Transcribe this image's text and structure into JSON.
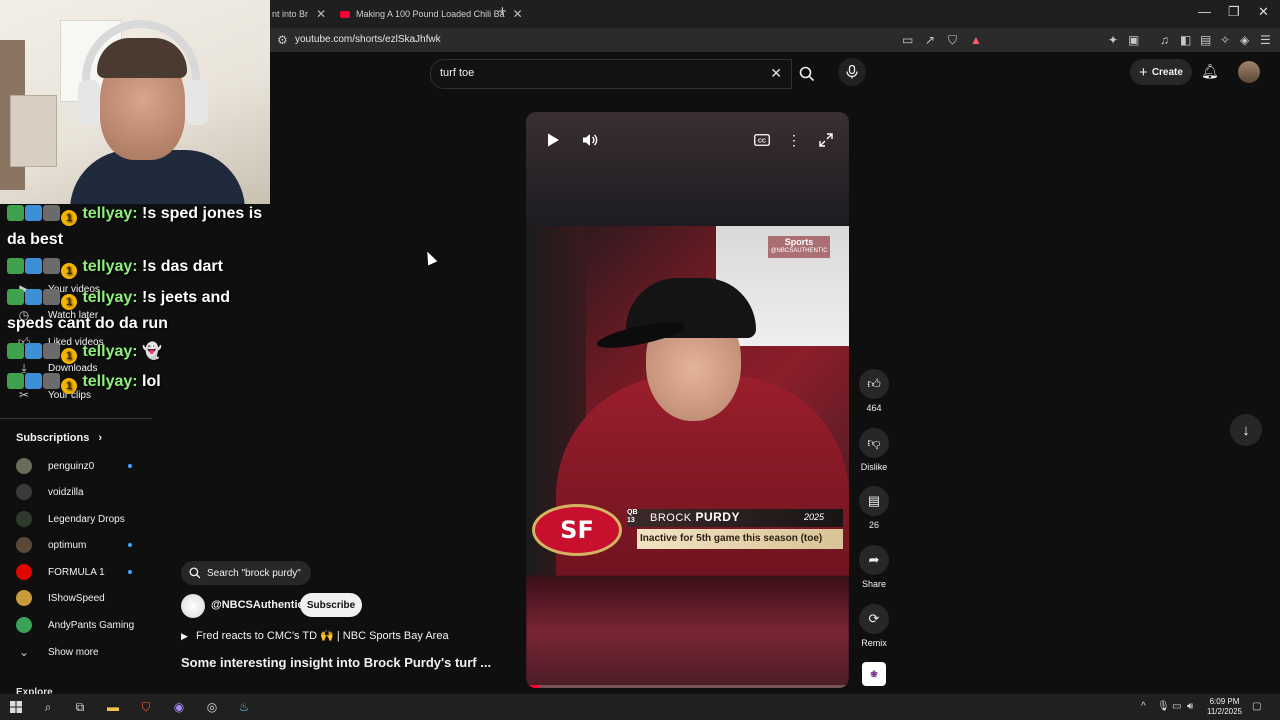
{
  "browser": {
    "tabs": [
      {
        "label": "nt into Br",
        "active": true
      },
      {
        "label": "Making A 100 Pound Loaded Chili Ba",
        "active": false
      }
    ],
    "new_tab": "+",
    "url": "youtube.com/shorts/ezlSkaJhfwk",
    "window_controls": {
      "minimize": "—",
      "restore": "❐",
      "close": "✕"
    }
  },
  "youtube": {
    "search_value": "turf toe",
    "create_label": "Create"
  },
  "chat": [
    {
      "user": "tellyay:",
      "message": "!s sped jones is da best",
      "level": "1"
    },
    {
      "user": "tellyay:",
      "message": "!s das dart",
      "level": "1"
    },
    {
      "user": "tellyay:",
      "message": "!s jeets and speds cant do da run",
      "level": "1"
    },
    {
      "user": "tellyay:",
      "message": "",
      "level": "1",
      "emote": "👻"
    },
    {
      "user": "tellyay:",
      "message": "lol",
      "level": "1"
    }
  ],
  "sidebar": {
    "items": [
      {
        "label": "Your videos",
        "icon": "video-icon"
      },
      {
        "label": "Watch later",
        "icon": "clock-icon"
      },
      {
        "label": "Liked videos",
        "icon": "thumbs-up-icon"
      },
      {
        "label": "Downloads",
        "icon": "download-icon"
      },
      {
        "label": "Your clips",
        "icon": "scissors-icon"
      }
    ],
    "subscriptions_heading": "Subscriptions",
    "subscriptions": [
      {
        "label": "penguinz0",
        "new": true,
        "color": "#6b6b5a"
      },
      {
        "label": "voidzilla",
        "new": false,
        "color": "#3a3a3a"
      },
      {
        "label": "Legendary Drops",
        "new": false,
        "color": "#2f3b2a"
      },
      {
        "label": "optimum",
        "new": true,
        "color": "#5a4838"
      },
      {
        "label": "FORMULA 1",
        "new": true,
        "color": "#e10600"
      },
      {
        "label": "IShowSpeed",
        "new": false,
        "color": "#c89a3a"
      },
      {
        "label": "AndyPants Gaming",
        "new": false,
        "color": "#3aa35a"
      }
    ],
    "show_more": "Show more",
    "explore": "Explore"
  },
  "video": {
    "overlay_brand": "Sports",
    "overlay_brand_sub": "@NBCSAUTHENTIC",
    "team_logo_text": "SF",
    "qb_tag": "QB 13",
    "player_first": "BROCK",
    "player_last": "PURDY",
    "year": "2025",
    "status": "Inactive for 5th game this season (toe)",
    "progress": 0.04
  },
  "below_video": {
    "suggestion": "Search \"brock purdy\"",
    "channel": "@NBCSAuthentic",
    "subscribe": "Subscribe",
    "related": "Fred reacts to CMC's TD 🙌 | NBC Sports Bay Area",
    "title": "Some interesting insight into Brock Purdy's turf ..."
  },
  "actions": {
    "like_count": "464",
    "dislike": "Dislike",
    "comments_count": "26",
    "share": "Share",
    "remix": "Remix"
  },
  "taskbar": {
    "time": "6:09 PM",
    "date": "11/2/2025"
  }
}
